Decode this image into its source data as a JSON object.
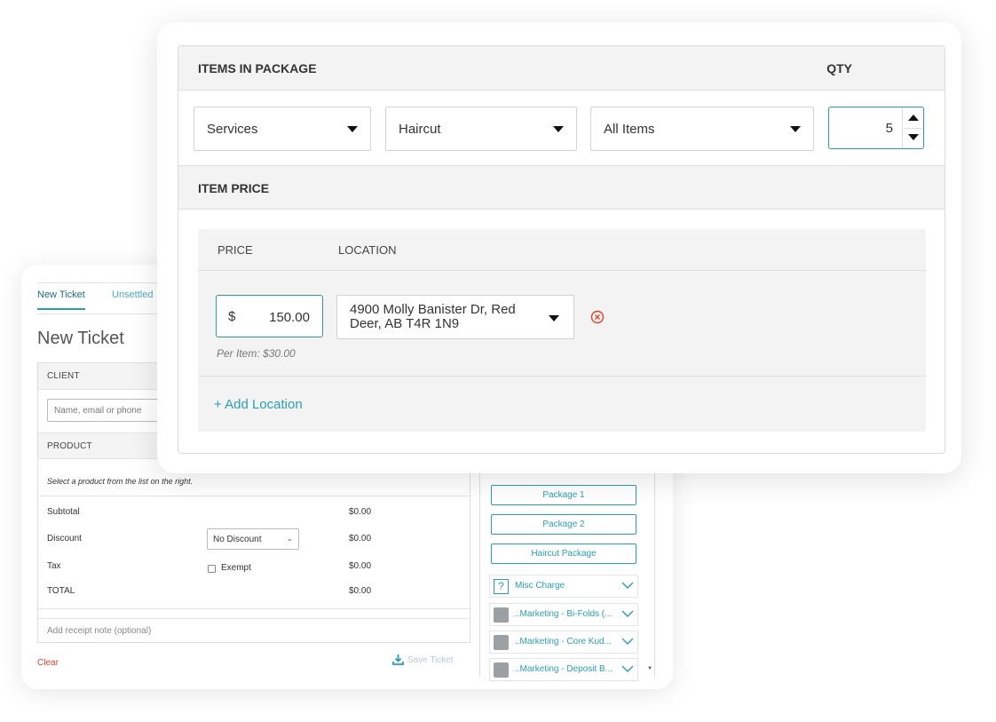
{
  "ticket": {
    "tabs": [
      "New Ticket",
      "Unsettled"
    ],
    "title": "New Ticket",
    "client_header": "CLIENT",
    "client_placeholder": "Name, email or phone",
    "product_header": "PRODUCT",
    "product_note": "Select a product from the list on the right.",
    "lines": {
      "subtotal_label": "Subtotal",
      "subtotal_value": "$0.00",
      "discount_label": "Discount",
      "discount_select": "No Discount",
      "discount_value": "$0.00",
      "tax_label": "Tax",
      "exempt_label": "Exempt",
      "tax_value": "$0.00",
      "total_label": "TOTAL",
      "total_value": "$0.00"
    },
    "receipt_note_placeholder": "Add receipt note (optional)",
    "clear_label": "Clear",
    "save_label": "Save Ticket"
  },
  "product_list": {
    "packages": [
      "Package 1",
      "Package 2",
      "Haircut Package"
    ],
    "categories": [
      {
        "label": "Misc Charge",
        "icon": "question-icon"
      },
      {
        "label": "..Marketing - Bi-Folds (...",
        "icon": "cube-icon"
      },
      {
        "label": "..Marketing - Core Kud...",
        "icon": "cube-icon"
      },
      {
        "label": "..Marketing - Deposit B...",
        "icon": "cube-icon"
      }
    ]
  },
  "package_editor": {
    "items_header": "ITEMS IN PACKAGE",
    "qty_header": "QTY",
    "category_select": "Services",
    "subcategory_select": "Haircut",
    "item_select": "All Items",
    "qty_value": "5",
    "price_header": "ITEM PRICE",
    "price_col": "PRICE",
    "location_col": "LOCATION",
    "currency": "$",
    "price_value": "150.00",
    "per_item": "Per Item: $30.00",
    "location_value": "4900 Molly Banister Dr, Red Deer, AB T4R 1N9",
    "add_location": "+ Add Location"
  },
  "colors": {
    "accent": "#2a9fb3",
    "focus_border": "#2e9e86",
    "danger": "#d9452b"
  }
}
